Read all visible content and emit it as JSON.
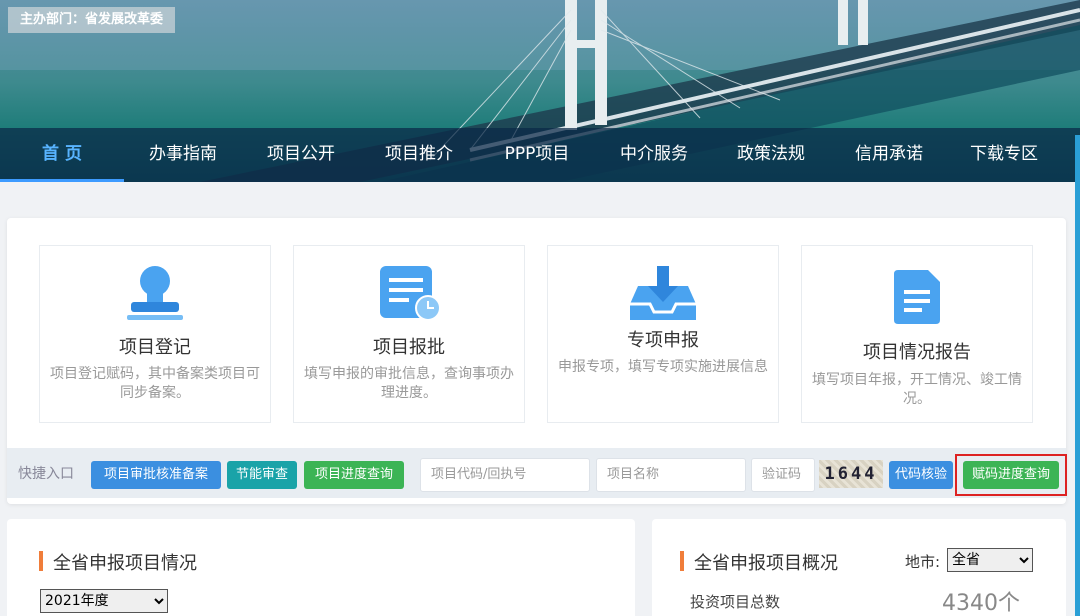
{
  "sponsor": "主办部门：省发展改革委",
  "nav": [
    "首页",
    "办事指南",
    "项目公开",
    "项目推介",
    "PPP项目",
    "中介服务",
    "政策法规",
    "信用承诺",
    "下载专区"
  ],
  "features": [
    {
      "title": "项目登记",
      "desc": "项目登记赋码，其中备案类项目可同步备案。"
    },
    {
      "title": "项目报批",
      "desc": "填写申报的审批信息，查询事项办理进度。"
    },
    {
      "title": "专项申报",
      "desc": "申报专项，填写专项实施进展信息"
    },
    {
      "title": "项目情况报告",
      "desc": "填写项目年报，开工情况、竣工情况。"
    }
  ],
  "quick": {
    "label": "快捷入口",
    "buttons": [
      "项目审批核准备案",
      "节能审查",
      "项目进度查询"
    ],
    "code_placeholder": "项目代码/回执号",
    "name_placeholder": "项目名称",
    "captcha_placeholder": "验证码",
    "captcha_text": "1644",
    "verify_btn": "代码核验",
    "progress_btn": "赋码进度查询"
  },
  "left_section": {
    "title": "全省申报项目情况",
    "year": "2021年度"
  },
  "right_section": {
    "title": "全省申报项目概况",
    "city_label": "地市:",
    "city": "全省",
    "stat_label": "投资项目总数",
    "stat_value": "4340个"
  },
  "colors": {
    "blue_btn": "#3b8fe0",
    "teal_btn": "#1aa3a8",
    "green_btn": "#3cb455",
    "accent": "#f07d3a"
  }
}
